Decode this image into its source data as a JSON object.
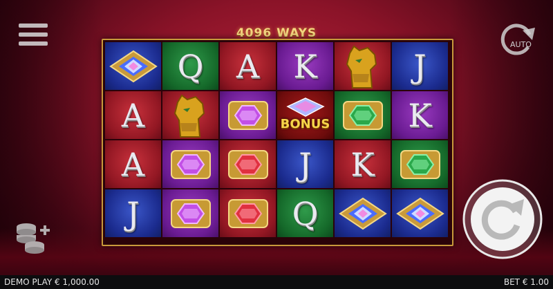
{
  "ways_label": "4096 WAYS",
  "auto_label": "AUTO",
  "hud": {
    "balance": "DEMO PLAY € 1,000.00",
    "bet": "BET € 1.00"
  },
  "bonus_label": "BONUS",
  "grid": [
    [
      {
        "symbol": "diamond-blue",
        "bg": "blue"
      },
      {
        "symbol": "Q",
        "bg": "green"
      },
      {
        "symbol": "A",
        "bg": "red"
      },
      {
        "symbol": "K",
        "bg": "purple"
      },
      {
        "symbol": "panther",
        "bg": "red"
      },
      {
        "symbol": "J",
        "bg": "blue"
      }
    ],
    [
      {
        "symbol": "A",
        "bg": "red"
      },
      {
        "symbol": "panther",
        "bg": "red"
      },
      {
        "symbol": "gem-purple",
        "bg": "purple"
      },
      {
        "symbol": "bonus",
        "bg": "darkred"
      },
      {
        "symbol": "gem-green",
        "bg": "green"
      },
      {
        "symbol": "K",
        "bg": "purple"
      }
    ],
    [
      {
        "symbol": "A",
        "bg": "red"
      },
      {
        "symbol": "gem-purple",
        "bg": "purple"
      },
      {
        "symbol": "gem-red",
        "bg": "red"
      },
      {
        "symbol": "J",
        "bg": "blue"
      },
      {
        "symbol": "K",
        "bg": "red"
      },
      {
        "symbol": "gem-green",
        "bg": "green"
      }
    ],
    [
      {
        "symbol": "J",
        "bg": "blue"
      },
      {
        "symbol": "gem-purple",
        "bg": "purple"
      },
      {
        "symbol": "gem-red",
        "bg": "red"
      },
      {
        "symbol": "Q",
        "bg": "green"
      },
      {
        "symbol": "diamond-blue",
        "bg": "blue"
      },
      {
        "symbol": "diamond-blue",
        "bg": "blue"
      }
    ]
  ],
  "icons": {
    "menu": "hamburger-menu-icon",
    "auto": "autoplay-icon",
    "spin": "spin-icon",
    "coins": "bet-coins-icon"
  }
}
